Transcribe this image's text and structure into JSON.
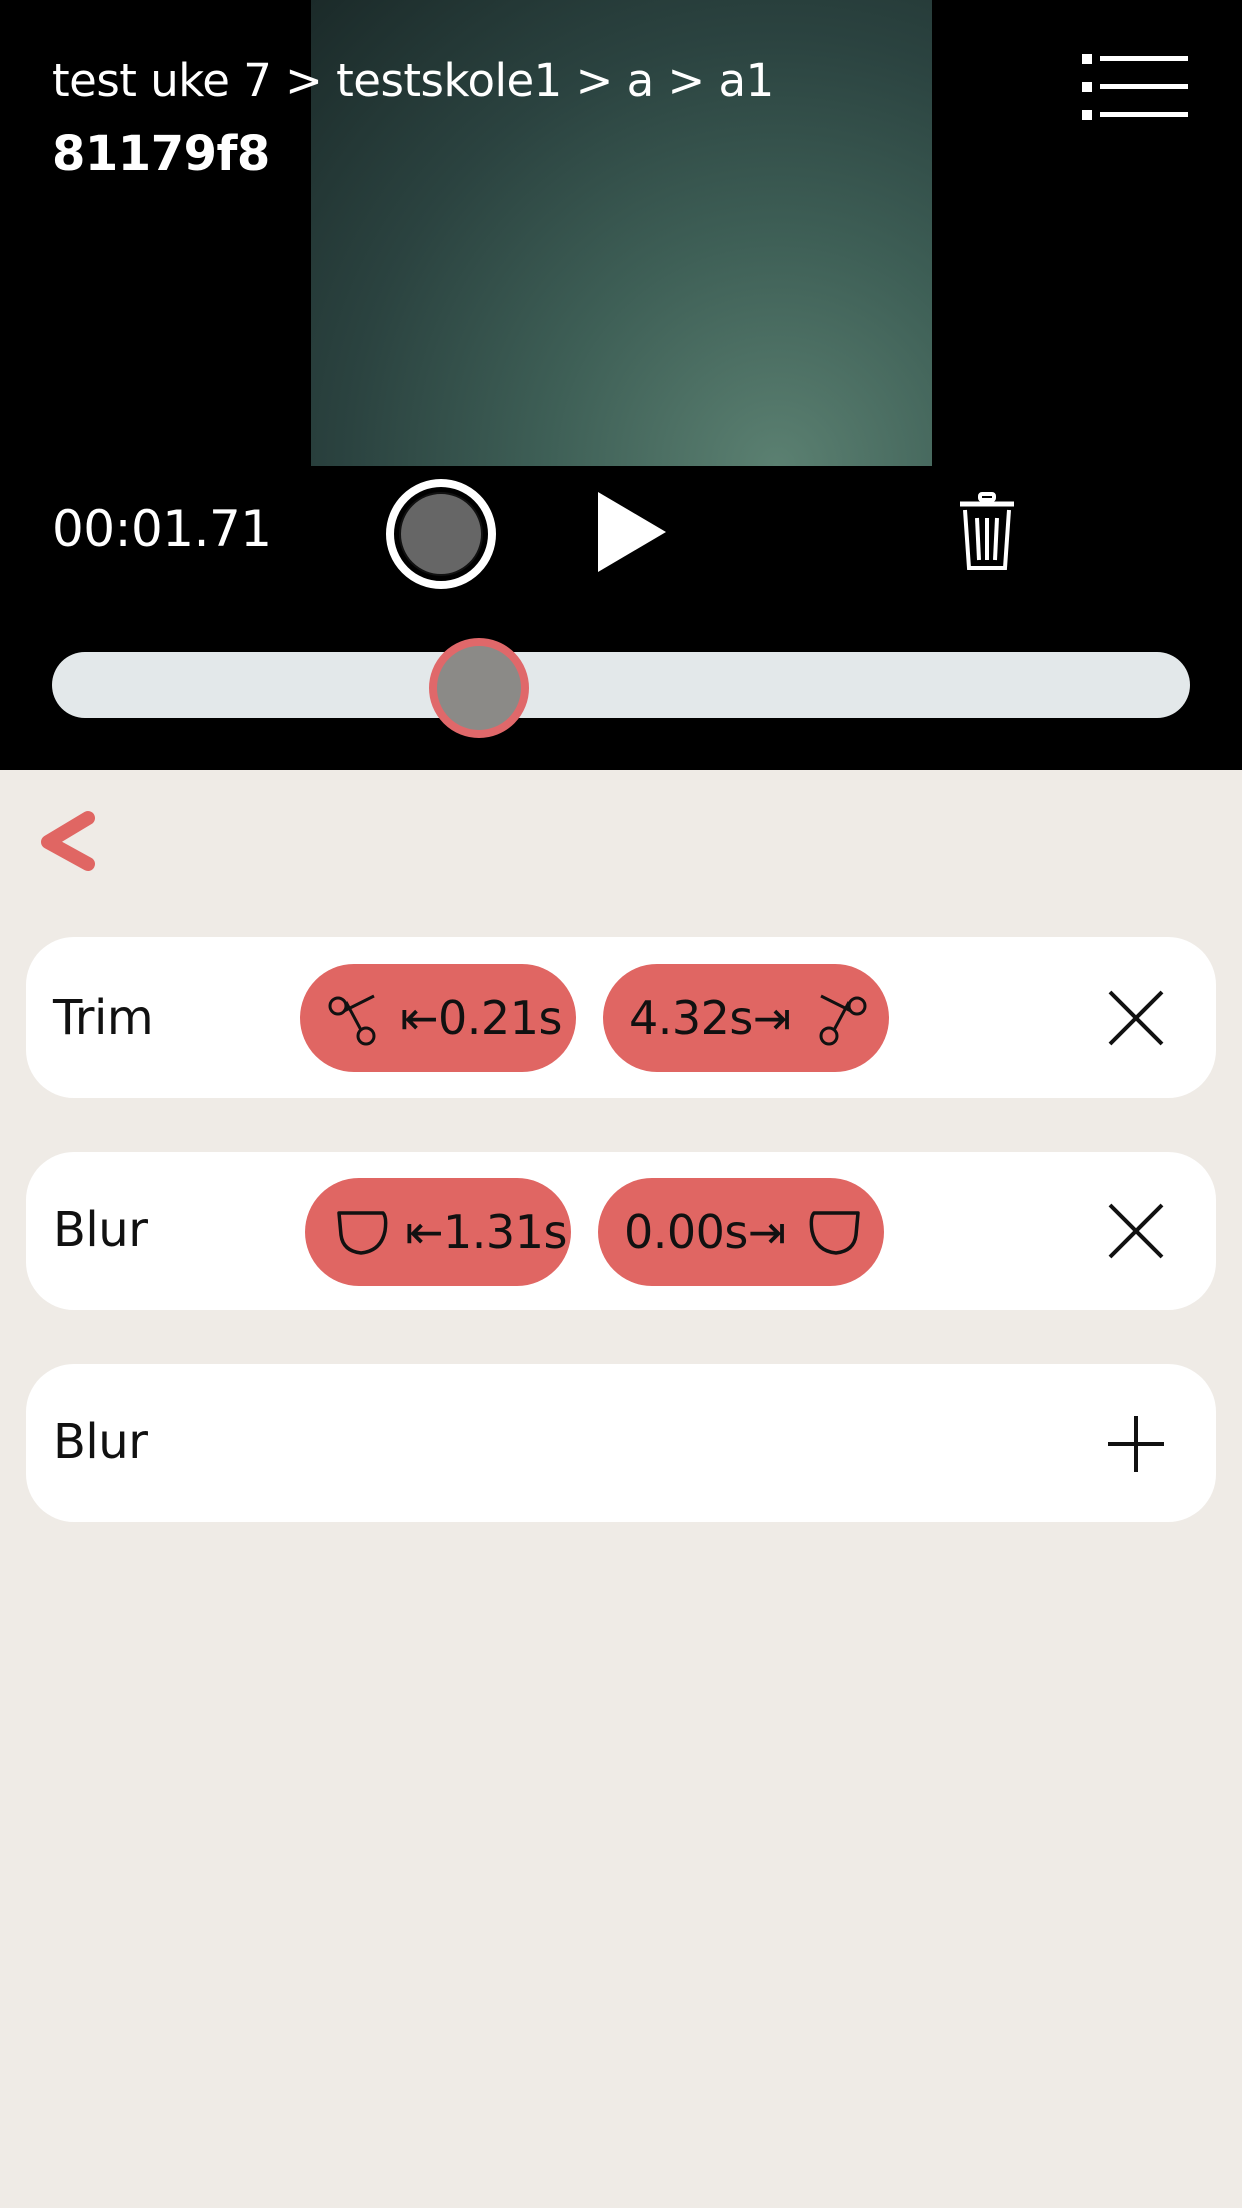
{
  "header": {
    "breadcrumb": "test uke 7 > testskole1 > a > a1",
    "video_id": "81179f8"
  },
  "player": {
    "time": "00:01.71",
    "scrubber_position": 0.375
  },
  "edits": [
    {
      "label": "Trim",
      "start": "⇤0.21s",
      "end": "4.32s⇥"
    },
    {
      "label": "Blur",
      "start": "⇤1.31s",
      "end": "0.00s⇥"
    }
  ],
  "add_row": {
    "label": "Blur"
  },
  "colors": {
    "accent": "#e06663",
    "background": "#efebe6",
    "card": "#ffffff"
  }
}
